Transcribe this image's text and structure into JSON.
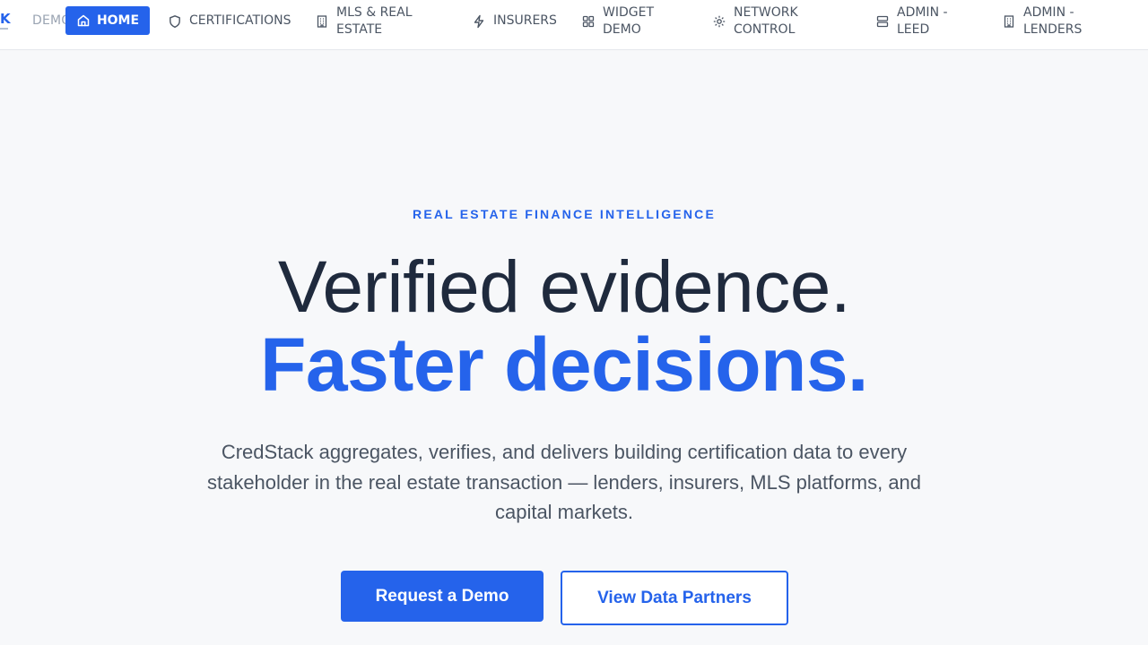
{
  "brand": {
    "logo_fragment": "K",
    "demo_fragment": "DEMO"
  },
  "nav": {
    "items": [
      {
        "label": "HOME",
        "icon": "home-icon",
        "active": true
      },
      {
        "label": "CERTIFICATIONS",
        "icon": "shield-icon"
      },
      {
        "label": "MLS & REAL\nESTATE",
        "icon": "building-icon"
      },
      {
        "label": "INSURERS",
        "icon": "lightning-icon"
      },
      {
        "label": "WIDGET\nDEMO",
        "icon": "grid-icon"
      },
      {
        "label": "NETWORK\nCONTROL",
        "icon": "gear-icon"
      },
      {
        "label": "ADMIN -\nLEED",
        "icon": "server-icon"
      },
      {
        "label": "ADMIN -\nLENDERS",
        "icon": "building-icon"
      }
    ]
  },
  "hero": {
    "eyebrow": "REAL ESTATE FINANCE INTELLIGENCE",
    "title_line1": "Verified evidence.",
    "title_line2": "Faster decisions.",
    "body": "CredStack aggregates, verifies, and delivers building certification data to every stakeholder in the real estate transaction — lenders, insurers, MLS platforms, and capital markets."
  },
  "cta": {
    "primary_label": "Request a Demo",
    "secondary_label": "View Data Partners"
  },
  "colors": {
    "accent": "#2563eb",
    "heading": "#1f2a3d",
    "body_text": "#4b5563",
    "page_bg": "#f7f8fa",
    "nav_bg": "#ffffff"
  }
}
